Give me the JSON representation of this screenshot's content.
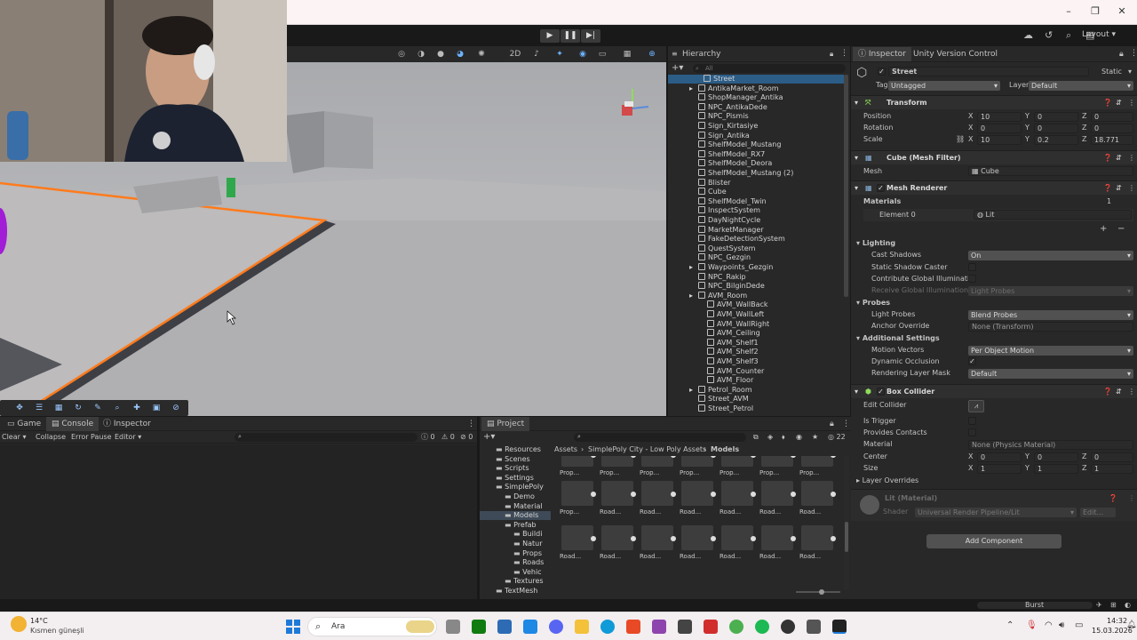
{
  "toolbar": {
    "layout_label": "Layout"
  },
  "scene": {
    "tools": [
      "move-tool",
      "rect-tool",
      "grid-tool",
      "rotate-tool",
      "paint-tool",
      "zoom-tool",
      "transform-tool",
      "gizmo-tool",
      "extra-tool"
    ]
  },
  "bottom_left": {
    "tabs": [
      "Game",
      "Console",
      "Inspector"
    ],
    "console_toolbar": {
      "clear": "Clear",
      "collapse": "Collapse",
      "error_pause": "Error Pause",
      "editor": "Editor",
      "info_count": "0",
      "warn_count": "0",
      "error_count": "0"
    }
  },
  "project": {
    "tab": "Project",
    "count": "22",
    "breadcrumb": [
      "Assets",
      "SimplePoly City - Low Poly Assets",
      "Models"
    ],
    "tree": [
      {
        "label": "Resources",
        "depth": 1
      },
      {
        "label": "Scenes",
        "depth": 1
      },
      {
        "label": "Scripts",
        "depth": 1
      },
      {
        "label": "Settings",
        "depth": 1
      },
      {
        "label": "SimplePoly",
        "depth": 1
      },
      {
        "label": "Demo",
        "depth": 2
      },
      {
        "label": "Material",
        "depth": 2
      },
      {
        "label": "Models",
        "depth": 2
      },
      {
        "label": "Prefab",
        "depth": 2
      },
      {
        "label": "Buildi",
        "depth": 3
      },
      {
        "label": "Natur",
        "depth": 3
      },
      {
        "label": "Props",
        "depth": 3
      },
      {
        "label": "Roads",
        "depth": 3
      },
      {
        "label": "Vehic",
        "depth": 3
      },
      {
        "label": "Textures",
        "depth": 2
      },
      {
        "label": "TextMesh",
        "depth": 1
      }
    ],
    "asset_rows": [
      [
        "Prop...",
        "Prop...",
        "Prop...",
        "Prop...",
        "Prop...",
        "Prop...",
        "Prop..."
      ],
      [
        "Prop...",
        "Road...",
        "Road...",
        "Road...",
        "Road...",
        "Road...",
        "Road..."
      ],
      [
        "Road...",
        "Road...",
        "Road...",
        "Road...",
        "Road...",
        "Road...",
        "Road..."
      ]
    ]
  },
  "hierarchy": {
    "title": "Hierarchy",
    "search_placeholder": "All",
    "items": [
      {
        "label": "Street",
        "depth": 0,
        "expand": false
      },
      {
        "label": "AntikaMarket_Room",
        "depth": 0,
        "expand": true
      },
      {
        "label": "ShopManager_Antika",
        "depth": 0,
        "expand": false
      },
      {
        "label": "NPC_AntikaDede",
        "depth": 0,
        "expand": false
      },
      {
        "label": "NPC_Pismis",
        "depth": 0,
        "expand": false
      },
      {
        "label": "Sign_Kirtasiye",
        "depth": 0,
        "expand": false
      },
      {
        "label": "Sign_Antika",
        "depth": 0,
        "expand": false
      },
      {
        "label": "ShelfModel_Mustang",
        "depth": 0,
        "expand": false
      },
      {
        "label": "ShelfModel_RX7",
        "depth": 0,
        "expand": false
      },
      {
        "label": "ShelfModel_Deora",
        "depth": 0,
        "expand": false
      },
      {
        "label": "ShelfModel_Mustang (2)",
        "depth": 0,
        "expand": false
      },
      {
        "label": "Blister",
        "depth": 0,
        "expand": false
      },
      {
        "label": "Cube",
        "depth": 0,
        "expand": false
      },
      {
        "label": "ShelfModel_Twin",
        "depth": 0,
        "expand": false
      },
      {
        "label": "InspectSystem",
        "depth": 0,
        "expand": false
      },
      {
        "label": "DayNightCycle",
        "depth": 0,
        "expand": false
      },
      {
        "label": "MarketManager",
        "depth": 0,
        "expand": false
      },
      {
        "label": "FakeDetectionSystem",
        "depth": 0,
        "expand": false
      },
      {
        "label": "QuestSystem",
        "depth": 0,
        "expand": false
      },
      {
        "label": "NPC_Gezgin",
        "depth": 0,
        "expand": false
      },
      {
        "label": "Waypoints_Gezgin",
        "depth": 0,
        "expand": true
      },
      {
        "label": "NPC_Rakip",
        "depth": 0,
        "expand": false
      },
      {
        "label": "NPC_BilginDede",
        "depth": 0,
        "expand": false
      },
      {
        "label": "AVM_Room",
        "depth": 0,
        "expand": true
      },
      {
        "label": "AVM_WallBack",
        "depth": 1,
        "expand": false
      },
      {
        "label": "AVM_WallLeft",
        "depth": 1,
        "expand": false
      },
      {
        "label": "AVM_WallRight",
        "depth": 1,
        "expand": false
      },
      {
        "label": "AVM_Ceiling",
        "depth": 1,
        "expand": false
      },
      {
        "label": "AVM_Shelf1",
        "depth": 1,
        "expand": false
      },
      {
        "label": "AVM_Shelf2",
        "depth": 1,
        "expand": false
      },
      {
        "label": "AVM_Shelf3",
        "depth": 1,
        "expand": false
      },
      {
        "label": "AVM_Counter",
        "depth": 1,
        "expand": false
      },
      {
        "label": "AVM_Floor",
        "depth": 1,
        "expand": false
      },
      {
        "label": "Petrol_Room",
        "depth": 0,
        "expand": true
      },
      {
        "label": "Street_AVM",
        "depth": 0,
        "expand": false
      },
      {
        "label": "Street_Petrol",
        "depth": 0,
        "expand": false
      }
    ]
  },
  "inspector": {
    "tabs": [
      "Inspector",
      "Unity Version Control"
    ],
    "object_name": "Street",
    "static_label": "Static",
    "tag_label": "Tag",
    "tag_value": "Untagged",
    "layer_label": "Layer",
    "layer_value": "Default",
    "transform": {
      "title": "Transform",
      "rows": [
        {
          "label": "Position",
          "x": "10",
          "y": "0",
          "z": "0"
        },
        {
          "label": "Rotation",
          "x": "0",
          "y": "0",
          "z": "0"
        },
        {
          "label": "Scale",
          "x": "10",
          "y": "0.2",
          "z": "18.771"
        }
      ]
    },
    "mesh_filter": {
      "title": "Cube (Mesh Filter)",
      "mesh_label": "Mesh",
      "mesh_value": "Cube"
    },
    "mesh_renderer": {
      "title": "Mesh Renderer",
      "materials_label": "Materials",
      "materials_count": "1",
      "element_label": "Element 0",
      "element_value": "Lit",
      "lighting_label": "Lighting",
      "cast_shadows_label": "Cast Shadows",
      "cast_shadows_value": "On",
      "static_shadow_label": "Static Shadow Caster",
      "contribute_gi_label": "Contribute Global Illuminatio",
      "receive_gi_label": "Receive Global Illumination",
      "receive_gi_value": "Light Probes",
      "probes_label": "Probes",
      "light_probes_label": "Light Probes",
      "light_probes_value": "Blend Probes",
      "anchor_label": "Anchor Override",
      "anchor_value": "None (Transform)",
      "additional_label": "Additional Settings",
      "motion_label": "Motion Vectors",
      "motion_value": "Per Object Motion",
      "occlusion_label": "Dynamic Occlusion",
      "rlm_label": "Rendering Layer Mask",
      "rlm_value": "Default"
    },
    "box_collider": {
      "title": "Box Collider",
      "edit_label": "Edit Collider",
      "trigger_label": "Is Trigger",
      "contacts_label": "Provides Contacts",
      "material_label": "Material",
      "material_value": "None (Physics Material)",
      "center_label": "Center",
      "center": {
        "x": "0",
        "y": "0",
        "z": "0"
      },
      "size_label": "Size",
      "size": {
        "x": "1",
        "y": "1",
        "z": "1"
      },
      "overrides_label": "Layer Overrides"
    },
    "material": {
      "title": "Lit (Material)",
      "shader_label": "Shader",
      "shader_value": "Universal Render Pipeline/Lit",
      "edit_label": "Edit..."
    },
    "add_component": "Add Component"
  },
  "status": {
    "burst": "Burst"
  },
  "taskbar": {
    "weather_temp": "14°C",
    "weather_desc": "Kısmen güneşli",
    "search": "Ara",
    "time": "14:32",
    "date": "15.03.2026"
  },
  "colors": {
    "accent": "#ff7b1c",
    "selection": "#2c5d87"
  }
}
